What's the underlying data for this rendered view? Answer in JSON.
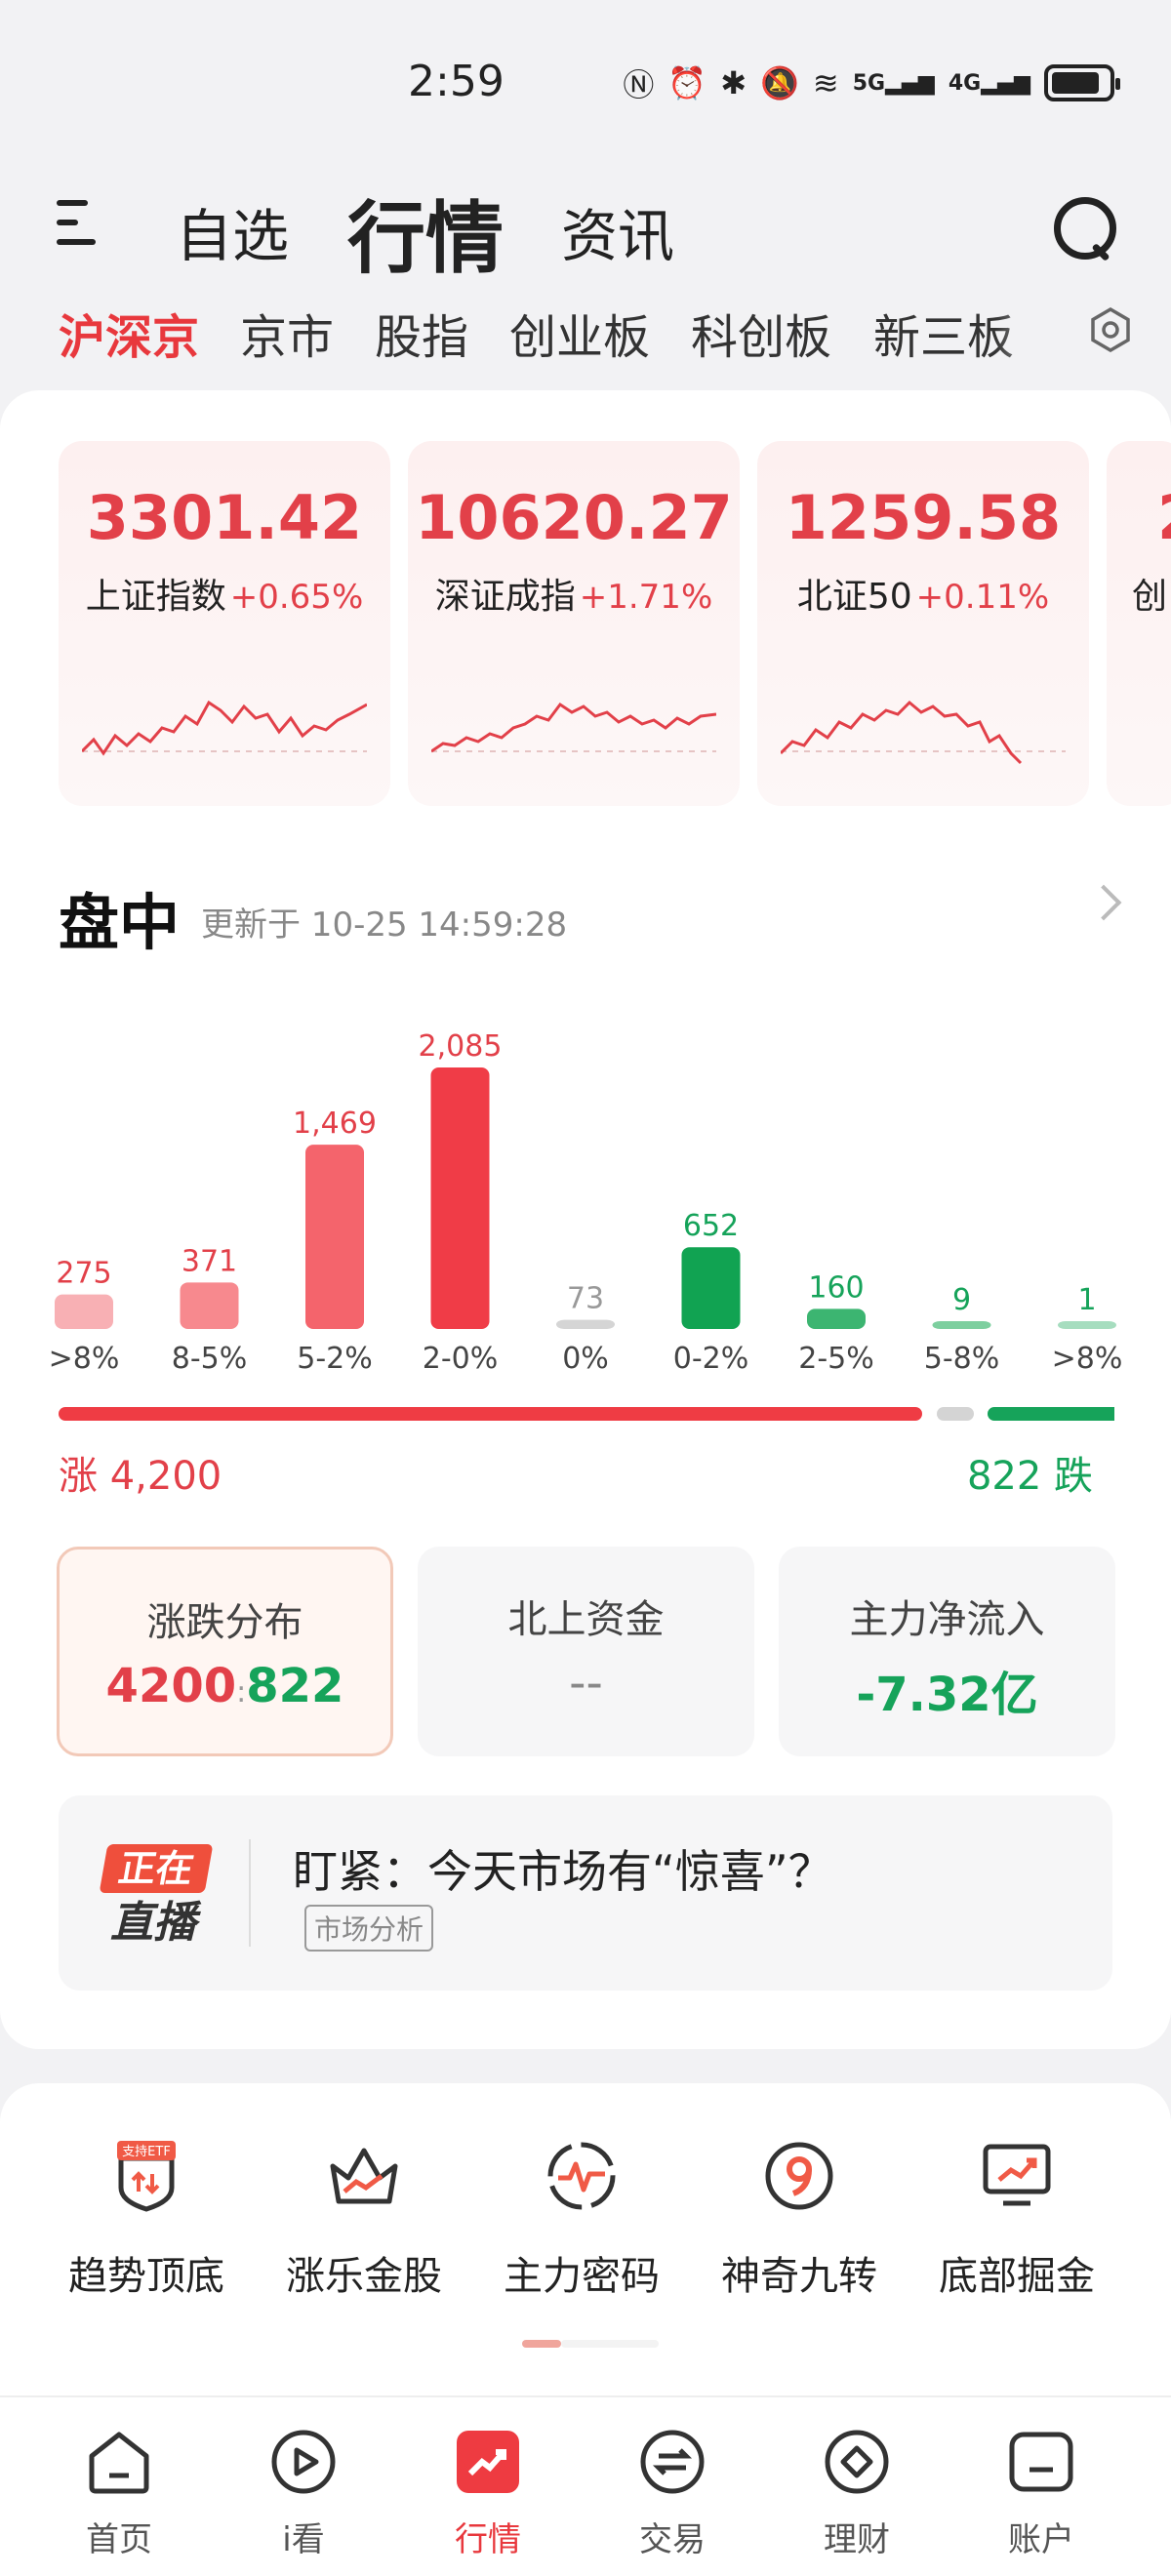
{
  "status_bar": {
    "time": "2:59",
    "signal_5g": "5G",
    "signal_4g": "4G"
  },
  "header": {
    "tabs": [
      {
        "label": "自选",
        "active": false
      },
      {
        "label": "行情",
        "active": true
      },
      {
        "label": "资讯",
        "active": false
      }
    ],
    "icons": [
      "menu-icon",
      "search-icon"
    ]
  },
  "market_tabs": [
    {
      "label": "沪深京",
      "active": true
    },
    {
      "label": "京市",
      "active": false
    },
    {
      "label": "股指",
      "active": false
    },
    {
      "label": "创业板",
      "active": false
    },
    {
      "label": "科创板",
      "active": false
    },
    {
      "label": "新三板",
      "active": false
    }
  ],
  "indices": [
    {
      "value": "3301.42",
      "name": "上证指数",
      "change": "+0.65%"
    },
    {
      "value": "10620.27",
      "name": "深证成指",
      "change": "+1.71%"
    },
    {
      "value": "1259.58",
      "name": "北证50",
      "change": "+0.11%"
    },
    {
      "value": "2",
      "name": "创",
      "change": ""
    }
  ],
  "intraday": {
    "title": "盘中",
    "updated": "更新于 10-25 14:59:28"
  },
  "chart_data": {
    "type": "bar",
    "categories": [
      ">8%",
      "8-5%",
      "5-2%",
      "2-0%",
      "0%",
      "0-2%",
      "2-5%",
      "5-8%",
      ">8%"
    ],
    "values": [
      275,
      371,
      1469,
      2085,
      73,
      652,
      160,
      9,
      1
    ],
    "value_labels": [
      "275",
      "371",
      "1,469",
      "2,085",
      "73",
      "652",
      "160",
      "9",
      "1"
    ],
    "colors": [
      "#f8b0b4",
      "#f7898e",
      "#f4646c",
      "#f03c47",
      "#d5d5d5",
      "#11a352",
      "#3cb571",
      "#7dcf9f",
      "#a6ddbf"
    ],
    "label_colors": [
      "#e24049",
      "#e24049",
      "#e24049",
      "#e24049",
      "#999999",
      "#16a35a",
      "#16a35a",
      "#16a35a",
      "#16a35a"
    ],
    "ylim": [
      0,
      2085
    ]
  },
  "breadth": {
    "up_label": "涨 4,200",
    "down_label": "822 跌",
    "up": 4200,
    "flat": 73,
    "down": 822
  },
  "stats": [
    {
      "title": "涨跌分布",
      "value_up": "4200",
      "value_sep": ":",
      "value_down": "822"
    },
    {
      "title": "北上资金",
      "value": "--"
    },
    {
      "title": "主力净流入",
      "value": "-7.32亿"
    }
  ],
  "live": {
    "badge_top": "正在",
    "badge_bottom": "直播",
    "title": "盯紧：今天市场有“惊喜”？",
    "tag": "市场分析"
  },
  "tools": [
    {
      "label": "趋势顶底",
      "icon": "trend-shield-icon",
      "badge": "支持ETF"
    },
    {
      "label": "涨乐金股",
      "icon": "crown-icon"
    },
    {
      "label": "主力密码",
      "icon": "pulse-icon"
    },
    {
      "label": "神奇九转",
      "icon": "nine-icon"
    },
    {
      "label": "底部掘金",
      "icon": "monitor-chart-icon"
    }
  ],
  "bottom_nav": [
    {
      "label": "首页",
      "icon": "home-icon",
      "active": false
    },
    {
      "label": "i看",
      "icon": "play-icon",
      "active": false
    },
    {
      "label": "行情",
      "icon": "market-icon",
      "active": true
    },
    {
      "label": "交易",
      "icon": "exchange-icon",
      "active": false
    },
    {
      "label": "理财",
      "icon": "diamond-icon",
      "active": false
    },
    {
      "label": "账户",
      "icon": "account-icon",
      "active": false
    }
  ]
}
